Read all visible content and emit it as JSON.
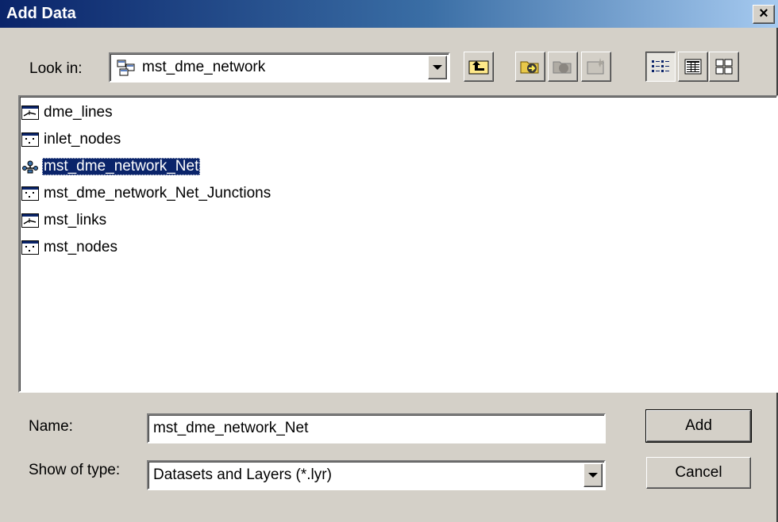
{
  "window": {
    "title": "Add Data",
    "close_glyph": "×"
  },
  "lookin": {
    "label": "Look in:",
    "value": "mst_dme_network",
    "icon": "geodatabase-icon"
  },
  "toolbar": {
    "buttons": [
      {
        "name": "up-one-level-icon"
      },
      {
        "name": "connect-folder-icon"
      },
      {
        "name": "disconnect-folder-icon"
      },
      {
        "name": "new-icon"
      },
      {
        "name": "list-view-icon"
      },
      {
        "name": "details-view-icon"
      },
      {
        "name": "thumbnails-view-icon"
      }
    ]
  },
  "list": {
    "items": [
      {
        "label": "dme_lines",
        "icon": "line-feature-class-icon"
      },
      {
        "label": "inlet_nodes",
        "icon": "point-feature-class-icon"
      },
      {
        "label": "mst_dme_network_Net",
        "icon": "geometric-network-icon",
        "selected": true
      },
      {
        "label": "mst_dme_network_Net_Junctions",
        "icon": "point-feature-class-icon"
      },
      {
        "label": "mst_links",
        "icon": "line-feature-class-icon"
      },
      {
        "label": "mst_nodes",
        "icon": "point-feature-class-icon"
      }
    ]
  },
  "name": {
    "label": "Name:",
    "value": "mst_dme_network_Net"
  },
  "type": {
    "label": "Show of type:",
    "value": "Datasets and Layers (*.lyr)"
  },
  "buttons": {
    "add": "Add",
    "cancel": "Cancel"
  }
}
